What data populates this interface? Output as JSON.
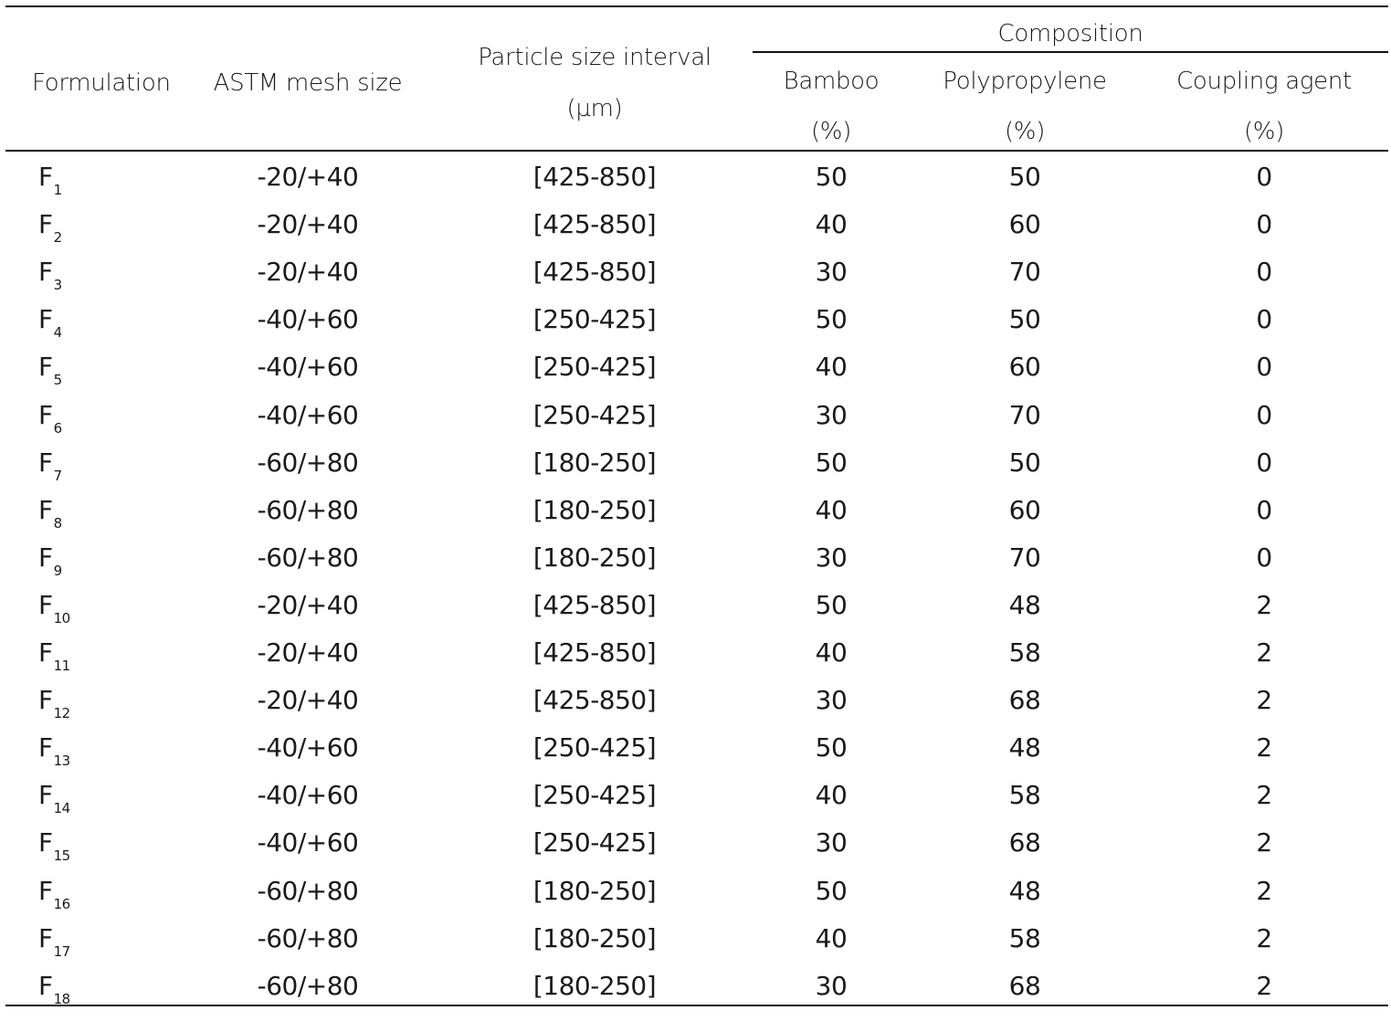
{
  "table": {
    "headers": {
      "formulation": "Formulation",
      "astm": "ASTM mesh size",
      "particle_line1": "Particle size interval",
      "particle_line2": "(µm)",
      "composition": "Composition",
      "bamboo": "Bamboo",
      "bamboo_unit": "(%)",
      "polypropylene": "Polypropylene",
      "polypropylene_unit": "(%)",
      "coupling": "Coupling agent",
      "coupling_unit": "(%)"
    },
    "rows": [
      {
        "f": "F",
        "sub": "1",
        "astm": "-20/+40",
        "interval": "[425-850]",
        "bamboo": "50",
        "pp": "50",
        "ca": "0"
      },
      {
        "f": "F",
        "sub": "2",
        "astm": "-20/+40",
        "interval": "[425-850]",
        "bamboo": "40",
        "pp": "60",
        "ca": "0"
      },
      {
        "f": "F",
        "sub": "3",
        "astm": "-20/+40",
        "interval": "[425-850]",
        "bamboo": "30",
        "pp": "70",
        "ca": "0"
      },
      {
        "f": "F",
        "sub": "4",
        "astm": "-40/+60",
        "interval": "[250-425]",
        "bamboo": "50",
        "pp": "50",
        "ca": "0"
      },
      {
        "f": "F",
        "sub": "5",
        "astm": "-40/+60",
        "interval": "[250-425]",
        "bamboo": "40",
        "pp": "60",
        "ca": "0"
      },
      {
        "f": "F",
        "sub": "6",
        "astm": "-40/+60",
        "interval": "[250-425]",
        "bamboo": "30",
        "pp": "70",
        "ca": "0"
      },
      {
        "f": "F",
        "sub": "7",
        "astm": "-60/+80",
        "interval": "[180-250]",
        "bamboo": "50",
        "pp": "50",
        "ca": "0"
      },
      {
        "f": "F",
        "sub": "8",
        "astm": "-60/+80",
        "interval": "[180-250]",
        "bamboo": "40",
        "pp": "60",
        "ca": "0"
      },
      {
        "f": "F",
        "sub": "9",
        "astm": "-60/+80",
        "interval": "[180-250]",
        "bamboo": "30",
        "pp": "70",
        "ca": "0"
      },
      {
        "f": "F",
        "sub": "10",
        "astm": "-20/+40",
        "interval": "[425-850]",
        "bamboo": "50",
        "pp": "48",
        "ca": "2"
      },
      {
        "f": "F",
        "sub": "11",
        "astm": "-20/+40",
        "interval": "[425-850]",
        "bamboo": "40",
        "pp": "58",
        "ca": "2"
      },
      {
        "f": "F",
        "sub": "12",
        "astm": "-20/+40",
        "interval": "[425-850]",
        "bamboo": "30",
        "pp": "68",
        "ca": "2"
      },
      {
        "f": "F",
        "sub": "13",
        "astm": "-40/+60",
        "interval": "[250-425]",
        "bamboo": "50",
        "pp": "48",
        "ca": "2"
      },
      {
        "f": "F",
        "sub": "14",
        "astm": "-40/+60",
        "interval": "[250-425]",
        "bamboo": "40",
        "pp": "58",
        "ca": "2"
      },
      {
        "f": "F",
        "sub": "15",
        "astm": "-40/+60",
        "interval": "[250-425]",
        "bamboo": "30",
        "pp": "68",
        "ca": "2"
      },
      {
        "f": "F",
        "sub": "16",
        "astm": "-60/+80",
        "interval": "[180-250]",
        "bamboo": "50",
        "pp": "48",
        "ca": "2"
      },
      {
        "f": "F",
        "sub": "17",
        "astm": "-60/+80",
        "interval": "[180-250]",
        "bamboo": "40",
        "pp": "58",
        "ca": "2"
      },
      {
        "f": "F",
        "sub": "18",
        "astm": "-60/+80",
        "interval": "[180-250]",
        "bamboo": "30",
        "pp": "68",
        "ca": "2"
      }
    ]
  }
}
